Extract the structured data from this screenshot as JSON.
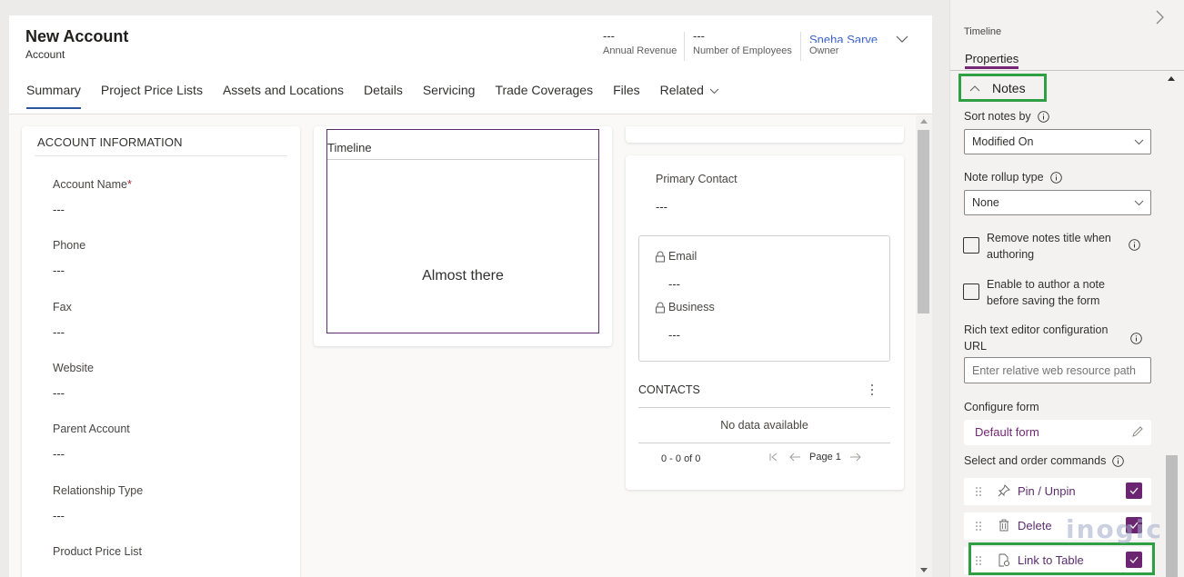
{
  "header": {
    "title": "New Account",
    "entity": "Account",
    "fields": [
      {
        "value": "---",
        "label": "Annual Revenue"
      },
      {
        "value": "---",
        "label": "Number of Employees"
      },
      {
        "value": "Sneha Sarve",
        "label": "Owner"
      }
    ],
    "expand_icon": "chevron-down-icon"
  },
  "tabs": [
    {
      "label": "Summary",
      "active": true
    },
    {
      "label": "Project Price Lists"
    },
    {
      "label": "Assets and Locations"
    },
    {
      "label": "Details"
    },
    {
      "label": "Servicing"
    },
    {
      "label": "Trade Coverages"
    },
    {
      "label": "Files"
    },
    {
      "label": "Related",
      "has_dropdown": true
    }
  ],
  "account_info": {
    "title": "ACCOUNT INFORMATION",
    "fields": [
      {
        "label": "Account Name",
        "required": "*",
        "value": "---"
      },
      {
        "label": "Phone",
        "value": "---"
      },
      {
        "label": "Fax",
        "value": "---"
      },
      {
        "label": "Website",
        "value": "---"
      },
      {
        "label": "Parent Account",
        "value": "---"
      },
      {
        "label": "Relationship Type",
        "value": "---"
      },
      {
        "label": "Product Price List",
        "value": ""
      }
    ]
  },
  "timeline": {
    "title": "Timeline",
    "message": "Almost there"
  },
  "primary_contact": {
    "label": "Primary Contact",
    "value": "---",
    "details": [
      {
        "label": "Email",
        "value": "---",
        "icon": "lock-icon"
      },
      {
        "label": "Business",
        "value": "---",
        "icon": "lock-icon"
      }
    ]
  },
  "contacts": {
    "title": "CONTACTS",
    "empty_message": "No data available",
    "count": "0 - 0 of 0",
    "page": "Page 1"
  },
  "pane": {
    "breadcrumb": "Timeline",
    "tab": "Properties",
    "section": "Notes",
    "sort_label": "Sort notes by",
    "sort_value": "Modified On",
    "rollup_label": "Note rollup type",
    "rollup_value": "None",
    "checkbox_remove_title": "Remove notes title when authoring",
    "checkbox_enable_author": "Enable to author a note before saving the form",
    "rte_label": "Rich text editor configuration URL",
    "rte_placeholder": "Enter relative web resource path",
    "configure_form_label": "Configure form",
    "configure_form_value": "Default form",
    "commands_label": "Select and order commands",
    "commands": [
      {
        "label": "Pin / Unpin",
        "icon": "pin-icon",
        "checked": true
      },
      {
        "label": "Delete",
        "icon": "trash-icon",
        "checked": true
      },
      {
        "label": "Link to Table",
        "icon": "link-document-icon",
        "checked": true
      }
    ]
  },
  "watermark": "inogic",
  "colors": {
    "accent": "#742774",
    "highlight": "#2ea043",
    "tab_underline": "#2b579a",
    "owner_link": "#3b62c9"
  }
}
